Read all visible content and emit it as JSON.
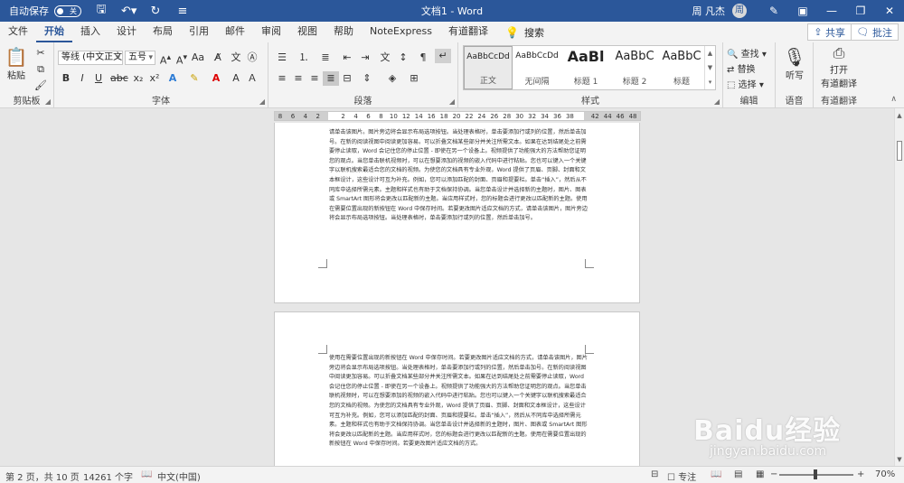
{
  "titlebar": {
    "autosave_label": "自动保存",
    "autosave_state": "关",
    "doc_title": "文档1 - Word",
    "user_name": "周 凡杰",
    "avatar_initial": "周"
  },
  "tabs": [
    "文件",
    "开始",
    "插入",
    "设计",
    "布局",
    "引用",
    "邮件",
    "审阅",
    "视图",
    "帮助",
    "NoteExpress",
    "有道翻译"
  ],
  "search_label": "搜索",
  "share_label": "共享",
  "comment_label": "批注",
  "ribbon": {
    "clipboard": {
      "label": "剪贴板",
      "paste": "粘贴"
    },
    "font": {
      "label": "字体",
      "font_name": "等线 (中文正文",
      "font_size": "五号"
    },
    "paragraph": {
      "label": "段落"
    },
    "styles": {
      "label": "样式",
      "items": [
        {
          "sample": "AaBbCcDd",
          "name": "正文"
        },
        {
          "sample": "AaBbCcDd",
          "name": "无间隔"
        },
        {
          "sample": "AaBl",
          "name": "标题 1"
        },
        {
          "sample": "AaBbC",
          "name": "标题 2"
        },
        {
          "sample": "AaBbC",
          "name": "标题"
        }
      ]
    },
    "editing": {
      "label": "编辑",
      "find": "查找",
      "replace": "替换",
      "select": "选择"
    },
    "voice": {
      "label": "语音",
      "dictate": "听写"
    },
    "youdao": {
      "label": "有道翻译",
      "open": "打开",
      "open2": "有道翻译"
    }
  },
  "ruler": {
    "h_numbers": [
      "8",
      "6",
      "4",
      "2",
      "",
      "2",
      "4",
      "6",
      "8",
      "10",
      "12",
      "14",
      "16",
      "18",
      "20",
      "22",
      "24",
      "26",
      "28",
      "30",
      "32",
      "34",
      "36",
      "38",
      "",
      "42",
      "44",
      "46",
      "48"
    ],
    "v_numbers": [
      "4",
      "2",
      "",
      "2",
      "4",
      "6",
      "8",
      "10",
      "12",
      "14"
    ]
  },
  "doc": {
    "page1_text": "请单击该图片。图片旁边将会显示布局选项按钮。当处理表格时，单击要添加行或列的位置，然后单击加号。在新的阅读视图中阅读更加容易。可以折叠文档某些部分并关注所需文本。如果在达到结尾处之前需要停止读取，Word 会记住您的停止位置 - 即使在另一个设备上。视频提供了功能强大的方法帮助您证明您的观点。当您单击联机视频时，可以在想要添加的视频的嵌入代码中进行粘贴。您也可以键入一个关键字以联机搜索最适合您的文档的视频。为使您的文档具有专业外观，Word 提供了页眉、页脚、封面和文本框设计，这些设计可互为补充。例如，您可以添加匹配的封面、页眉和提要栏。单击“插入”，然后从不同库中选择所需元素。主题和样式也有助于文档保持协调。当您单击设计并选择新的主题时，图片、图表或 SmartArt 图形将会更改以匹配新的主题。当应用样式时，您的标题会进行更改以匹配新的主题。使用在需要位置出现的新按钮在 Word 中保存时间。若要更改图片适应文档的方式，请单击该图片，图片旁边将会显示布局选项按钮。当处理表格时，单击要添加行或列的位置，然后单击加号。",
    "page2_text": "使用在需要位置出现的新按钮在 Word 中保存时间。若要更改图片适应文档的方式，请单击该图片，图片旁边将会显示布局选项按钮。当处理表格时，单击要添加行或列的位置，然后单击加号。在新的阅读视图中阅读更加容易。可以折叠文档某些部分并关注所需文本。如果在达到结尾处之前需要停止读取，Word 会记住您的停止位置 - 即使在另一个设备上。视频提供了功能强大的方法帮助您证明您的观点。当您单击联机视频时，可以在想要添加的视频的嵌入代码中进行粘贴。您也可以键入一个关键字以联机搜索最适合您的文档的视频。为使您的文档具有专业外观，Word 提供了页眉、页脚、封面和文本框设计，这些设计可互为补充。例如，您可以添加匹配的封面、页眉和提要栏。单击“插入”，然后从不同库中选择所需元素。主题和样式也有助于文档保持协调。当您单击设计并选择新的主题时，图片、图表或 SmartArt 图形将会更改以匹配新的主题。当应用样式时，您的标题会进行更改以匹配新的主题。使用在需要位置出现的新按钮在 Word 中保存时间。若要更改图片适应文档的方式。"
  },
  "status": {
    "page": "第 2 页，共 10 页",
    "words": "14261 个字",
    "language": "中文(中国)",
    "focus": "专注",
    "zoom": "70%"
  },
  "watermark": {
    "text": "Baidu经验",
    "url": "jingyan.baidu.com"
  },
  "colors": {
    "accent": "#2b579a",
    "title_bg": "#2b579a",
    "ribbon_bg": "#f3f3f3",
    "canvas_bg": "#e6e6e6"
  }
}
